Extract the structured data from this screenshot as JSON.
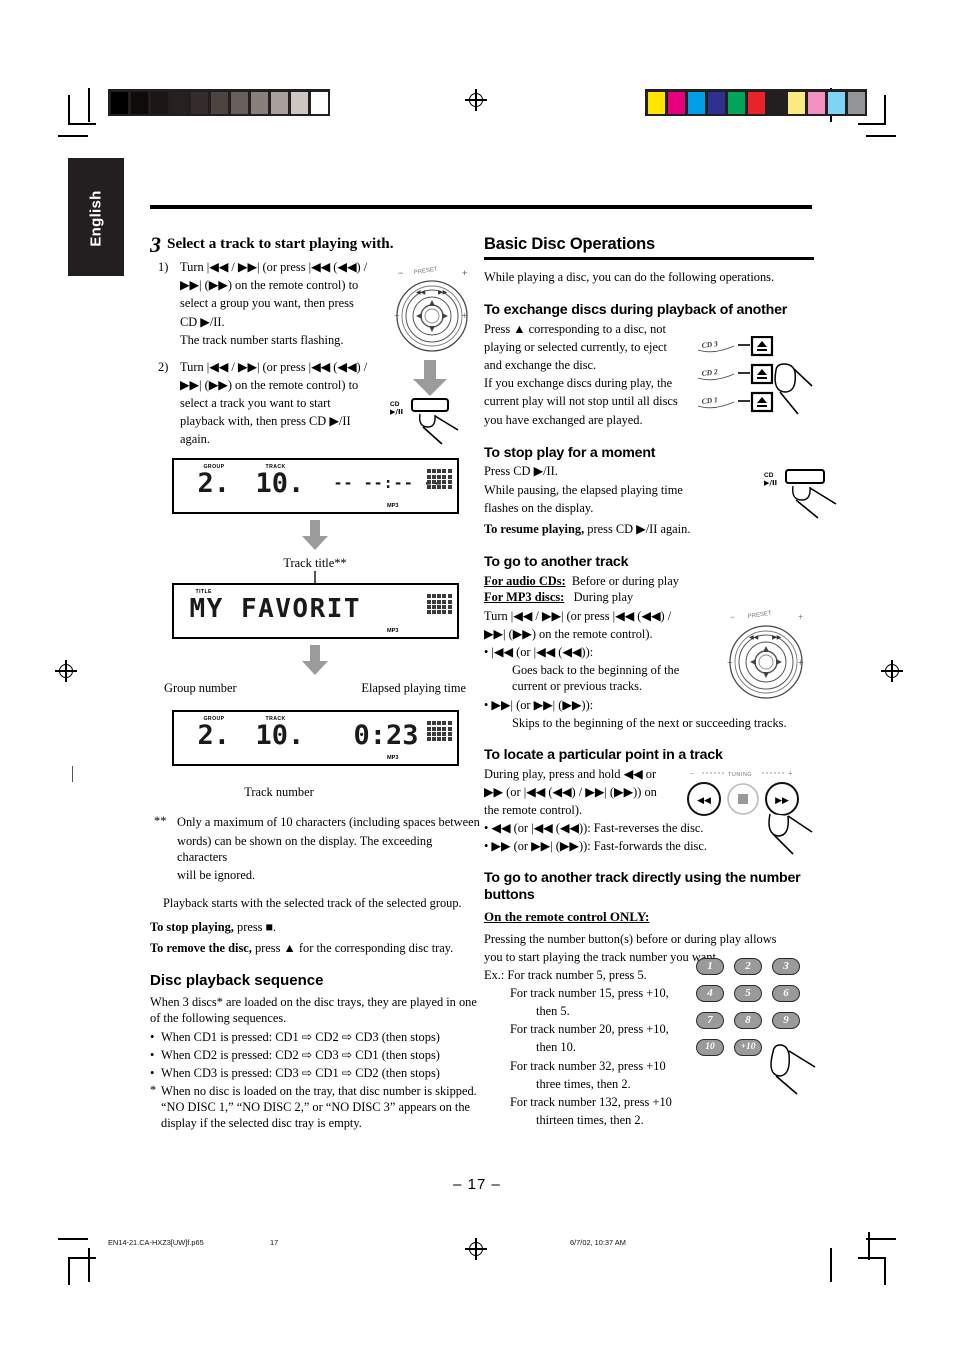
{
  "page": {
    "language_tab": "English",
    "page_number": "– 17 –"
  },
  "footer": {
    "filename": "EN14-21.CA-HXZ3[UW]f.p65",
    "folio": "17",
    "timestamp": "6/7/02, 10:37 AM"
  },
  "colorbars": {
    "gray": [
      "#000000",
      "#0f0b0b",
      "#1b1515",
      "#262020",
      "#342c2a",
      "#4d4340",
      "#6b5f5b",
      "#897f7b",
      "#a8a09c",
      "#cdc6c2",
      "#ffffff"
    ],
    "color": [
      "#ffe400",
      "#e6007e",
      "#00a0e4",
      "#2e3192",
      "#00a65a",
      "#e8232a",
      "#231f20",
      "#fbea7e",
      "#f391c2",
      "#7fd4f2",
      "#939598"
    ]
  },
  "left": {
    "step_number": "3",
    "step_title": "Select a track to start playing with.",
    "items": [
      {
        "marker": "1)",
        "lines": [
          "Turn |◀◀ / ▶▶| (or press |◀◀ (◀◀) /",
          "▶▶| (▶▶) on the remote control) to",
          "select a group you want, then press",
          "CD ▶/II.",
          "The track number starts flashing."
        ]
      },
      {
        "marker": "2)",
        "lines": [
          "Turn |◀◀ / ▶▶| (or press |◀◀ (◀◀) /",
          "▶▶| (▶▶) on the remote control) to",
          "select a track you want to start",
          "playback with, then press CD ▶/II",
          "again."
        ]
      }
    ],
    "display1": {
      "group_tag": "GROUP",
      "track_tag": "TRACK",
      "group": "2.",
      "track": "10.",
      "time": "-- --:-- --",
      "mp3": "MP3"
    },
    "caption_track_title": "Track title**",
    "display2": {
      "title_tag": "TITLE",
      "text": "MY FAVORIT",
      "mp3": "MP3"
    },
    "label_group_number": "Group number",
    "label_elapsed_time": "Elapsed playing time",
    "display3": {
      "group_tag": "GROUP",
      "track_tag": "TRACK",
      "group": "2.",
      "track": "10.",
      "time": "0:23",
      "mp3": "MP3"
    },
    "label_track_number": "Track number",
    "footnote_marker": "**",
    "footnote_lines": [
      "Only a maximum of 10 characters (including spaces between",
      "words) can be shown on the display. The exceeding characters",
      "will be ignored."
    ],
    "playback_note": "Playback starts with the selected track of the selected group.",
    "stop_playing_bold": "To stop playing,",
    "stop_playing_rest": "press ■.",
    "remove_disc_bold": "To remove the disc,",
    "remove_disc_rest": "press ▲ for the corresponding disc tray.",
    "sequence_heading": "Disc playback sequence",
    "sequence_intro": "When 3 discs* are loaded on the disc trays, they are played in one of the following sequences.",
    "sequence_bullets": [
      "When CD1 is pressed: CD1 ⇨ CD2 ⇨ CD3 (then stops)",
      "When CD2 is pressed: CD2 ⇨ CD3 ⇨ CD1 (then stops)",
      "When CD3 is pressed: CD3 ⇨ CD1 ⇨ CD2 (then stops)"
    ],
    "sequence_footnote_marker": "*",
    "sequence_footnote": "When no disc is loaded on the tray, that disc number is skipped. “NO DISC 1,” “NO DISC 2,” or “NO DISC 3” appears on the display if the selected disc tray is empty."
  },
  "right": {
    "section_title": "Basic Disc Operations",
    "intro": "While playing a disc, you can do the following operations.",
    "exchange": {
      "heading": "To exchange discs during playback of another",
      "lines": [
        "Press ▲ corresponding to a disc, not",
        "playing or selected currently, to eject",
        "and exchange the disc.",
        "If you exchange discs during play, the",
        "current play will not stop until all discs",
        "you have exchanged are played."
      ],
      "tray_labels": [
        "CD 3",
        "CD 2",
        "CD 1"
      ]
    },
    "stop_moment": {
      "heading": "To stop play for a moment",
      "lines": [
        "Press CD ▶/II.",
        "While pausing, the elapsed playing time",
        "flashes on the display."
      ],
      "resume_bold": "To resume playing,",
      "resume_rest": "press CD ▶/II again.",
      "button_label_top": "CD",
      "button_label_bottom": "▶/II"
    },
    "another_track": {
      "heading": "To go to another track",
      "audio_label": "For audio CDs:",
      "audio_value": "Before or during play",
      "mp3_label": "For MP3 discs:",
      "mp3_value": "During play",
      "lines": [
        "Turn |◀◀ / ▶▶| (or press |◀◀ (◀◀) /",
        "▶▶| (▶▶) on the remote control)."
      ],
      "bullets": [
        {
          "key": "• |◀◀ (or |◀◀ (◀◀)):",
          "desc": "Goes back to the beginning of the current or previous tracks."
        },
        {
          "key": "• ▶▶| (or ▶▶| (▶▶)):",
          "desc": "Skips to the beginning of the next or succeeding tracks."
        }
      ],
      "dial_label": "PRESET"
    },
    "locate": {
      "heading": "To locate a particular point in a track",
      "lines": [
        "During play, press and hold ◀◀ or",
        "▶▶ (or |◀◀ (◀◀) / ▶▶| (▶▶)) on",
        "the remote control)."
      ],
      "bullets": [
        "• ◀◀ (or |◀◀ (◀◀)):  Fast-reverses the disc.",
        "• ▶▶ (or ▶▶| (▶▶)):  Fast-forwards the disc."
      ],
      "tuning_label": "TUNING"
    },
    "number_buttons": {
      "heading": "To go to another track directly using the number buttons",
      "subheading": "On the remote control ONLY:",
      "lines": [
        "Pressing the number button(s) before or during play allows",
        "you to start playing the track number you want."
      ],
      "examples": [
        {
          "main": "Ex.: For track number 5, press 5.",
          "cont": ""
        },
        {
          "main": "For track number 15, press +10,",
          "cont": "then 5."
        },
        {
          "main": "For track number 20, press +10,",
          "cont": "then 10."
        },
        {
          "main": "For track number 32, press +10",
          "cont": "three times, then 2."
        },
        {
          "main": "For track number 132, press +10",
          "cont": "thirteen times, then 2."
        }
      ],
      "keys": [
        "1",
        "2",
        "3",
        "4",
        "5",
        "6",
        "7",
        "8",
        "9",
        "10",
        "+10"
      ]
    }
  }
}
